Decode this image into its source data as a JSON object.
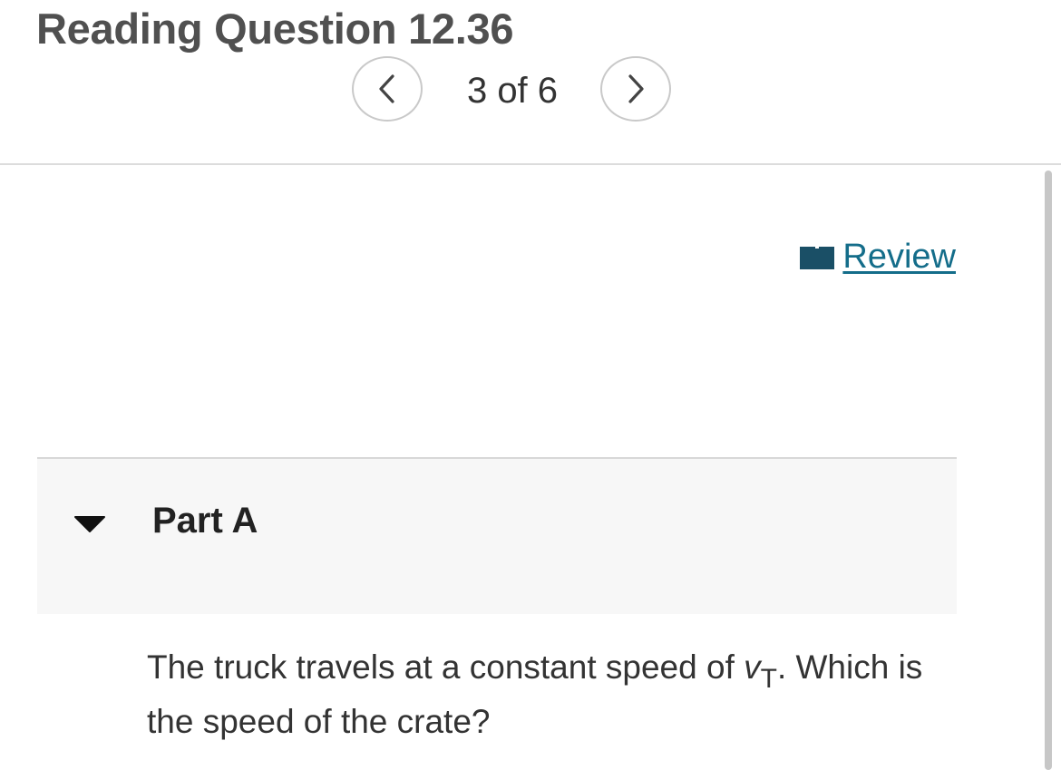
{
  "header": {
    "title": "Reading Question 12.36",
    "prev_icon": "chevron-left-icon",
    "next_icon": "chevron-right-icon",
    "counter": "3 of 6"
  },
  "review": {
    "label": "Review",
    "icon": "book-icon",
    "color": "#146d8a"
  },
  "part": {
    "title": "Part A",
    "expanded": true,
    "toggle_icon": "caret-down-icon"
  },
  "question": {
    "text_before": "The truck travels at a constant speed of ",
    "variable": "v",
    "subscript": "T",
    "text_after": ". Which is the speed of the crate?"
  }
}
